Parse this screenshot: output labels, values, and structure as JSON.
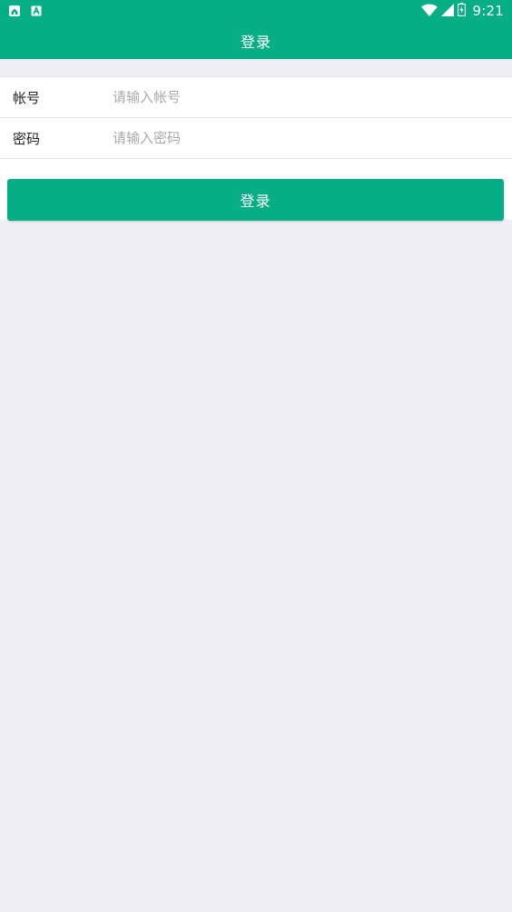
{
  "status_bar": {
    "time": "9:21",
    "left_icons": [
      "home-app-icon",
      "a-app-icon"
    ],
    "right_icons": [
      "wifi-icon",
      "signal-icon",
      "battery-icon"
    ]
  },
  "app_bar": {
    "title": "登录"
  },
  "form": {
    "account": {
      "label": "帐号",
      "placeholder": "请输入帐号",
      "value": ""
    },
    "password": {
      "label": "密码",
      "placeholder": "请输入密码",
      "value": ""
    }
  },
  "login_button": {
    "label": "登录"
  },
  "colors": {
    "primary": "#06ae86",
    "background": "#efeef4",
    "surface": "#ffffff",
    "placeholder": "#a9a9a9"
  }
}
